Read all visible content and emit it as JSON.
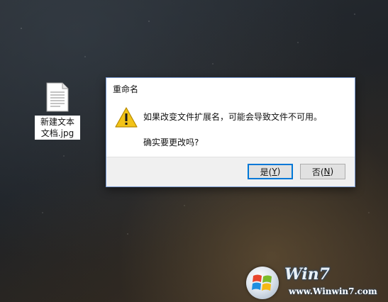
{
  "desktop": {
    "icon_label": "新建文本文档.jpg"
  },
  "dialog": {
    "title": "重命名",
    "message_line1": "如果改变文件扩展名，可能会导致文件不可用。",
    "message_line2": "确实要更改吗?",
    "yes_button": {
      "text": "是(",
      "mnemonic": "Y",
      "close": ")"
    },
    "no_button": {
      "text": "否(",
      "mnemonic": "N",
      "close": ")"
    },
    "warning_icon": "warning-triangle-icon"
  },
  "watermark": {
    "logo_text": "Win7",
    "url": "www.Winwin7.com"
  },
  "colors": {
    "dialog_border": "#7a9bd3",
    "default_button_border": "#0078d7",
    "warning_yellow": "#f2c318"
  }
}
